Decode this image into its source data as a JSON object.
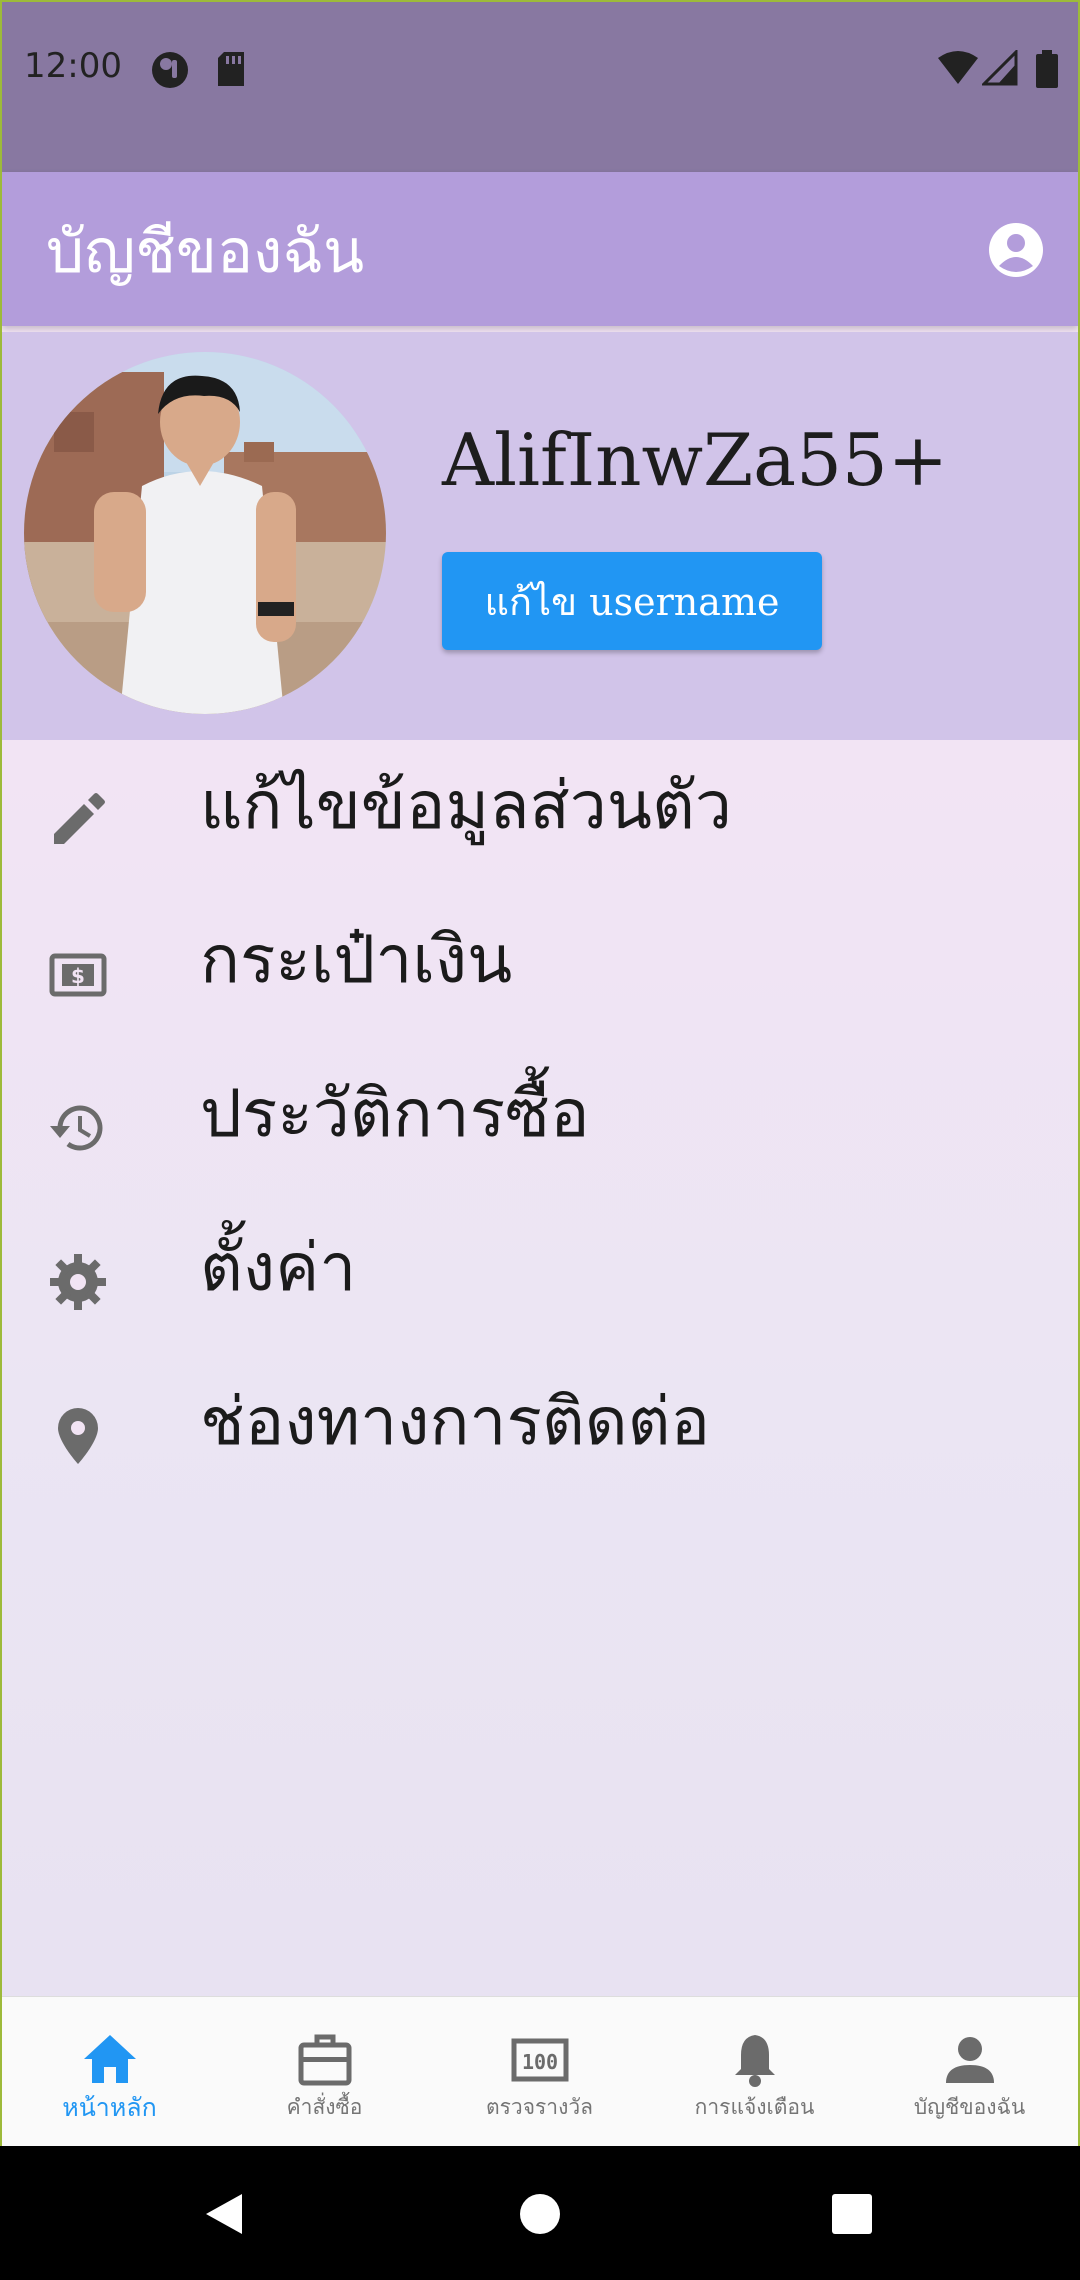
{
  "status_bar": {
    "time": "12:00"
  },
  "app_bar": {
    "title": "บัญชีของฉัน",
    "action_icon": "account-circle-icon"
  },
  "profile": {
    "username": "AlifInwZa55+",
    "edit_username_label": "แก้ไข username"
  },
  "menu": {
    "items": [
      {
        "label": "แก้ไขข้อมูลส่วนตัว",
        "icon": "pencil-icon"
      },
      {
        "label": "กระเป๋าเงิน",
        "icon": "wallet-icon"
      },
      {
        "label": "ประวัติการซื้อ",
        "icon": "history-icon"
      },
      {
        "label": "ตั้งค่า",
        "icon": "gear-icon"
      },
      {
        "label": "ช่องทางการติดต่อ",
        "icon": "location-pin-icon"
      }
    ]
  },
  "bottom_nav": {
    "items": [
      {
        "label": "หน้าหลัก",
        "icon": "home-icon",
        "active": true
      },
      {
        "label": "คำสั่งซื้อ",
        "icon": "briefcase-icon",
        "active": false
      },
      {
        "label": "ตรวจรางวัล",
        "icon": "lottery-icon",
        "active": false
      },
      {
        "label": "การแจ้งเตือน",
        "icon": "bell-icon",
        "active": false
      },
      {
        "label": "บัญชีของฉัน",
        "icon": "person-icon",
        "active": false
      }
    ]
  },
  "colors": {
    "status_bar": "#8878a1",
    "app_bar": "#b39ddb",
    "profile_bg": "#d1c4e9",
    "accent": "#2196f3",
    "body_bg": "#f2e4f4"
  }
}
